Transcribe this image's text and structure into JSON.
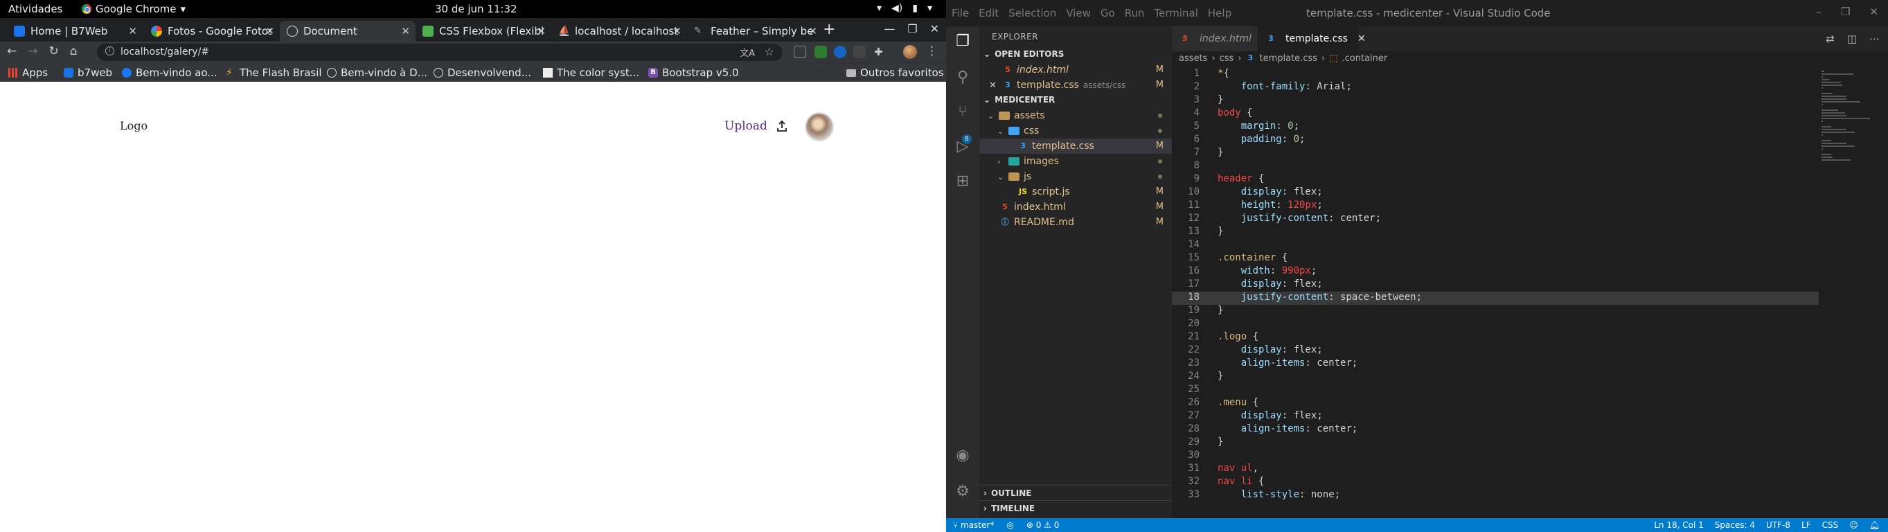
{
  "system": {
    "activities": "Atividades",
    "app_name": "Google Chrome",
    "clock": "30 de jun  11:32"
  },
  "chrome": {
    "tabs": [
      {
        "title": "Home | B7Web",
        "active": false
      },
      {
        "title": "Fotos - Google Fotos",
        "active": false
      },
      {
        "title": "Document",
        "active": true
      },
      {
        "title": "CSS Flexbox (Flexible",
        "active": false
      },
      {
        "title": "localhost / localhost",
        "active": false
      },
      {
        "title": "Feather – Simply be",
        "active": false
      }
    ],
    "url": "localhost/galery/#",
    "bookmarks": [
      {
        "label": "Apps",
        "icon": "apps-grid-icon"
      },
      {
        "label": "b7web",
        "icon": "b7web-icon"
      },
      {
        "label": "Bem-vindo ao...",
        "icon": "facebook-icon"
      },
      {
        "label": "The Flash Brasil",
        "icon": "flash-icon"
      },
      {
        "label": "Bem-vindo à D...",
        "icon": "globe-icon"
      },
      {
        "label": "Desenvolvend...",
        "icon": "globe-icon"
      },
      {
        "label": "The color syst...",
        "icon": "bookmark-icon"
      },
      {
        "label": "Bootstrap v5.0",
        "icon": "bootstrap-icon"
      }
    ],
    "other_bookmarks": "Outros favoritos"
  },
  "webpage": {
    "logo": "Logo",
    "upload": "Upload"
  },
  "vscode": {
    "menu": [
      "File",
      "Edit",
      "Selection",
      "View",
      "Go",
      "Run",
      "Terminal",
      "Help"
    ],
    "title": "template.css - medicenter - Visual Studio Code",
    "explorer_label": "EXPLORER",
    "open_editors_label": "OPEN EDITORS",
    "open_editors": [
      {
        "name": "index.html",
        "path": "",
        "status": "M",
        "type": "html"
      },
      {
        "name": "template.css",
        "path": "assets/css",
        "status": "M",
        "type": "css"
      }
    ],
    "project_label": "MEDICENTER",
    "tree": [
      {
        "name": "assets",
        "kind": "folder",
        "depth": 0,
        "open": true
      },
      {
        "name": "css",
        "kind": "folder-blue",
        "depth": 1,
        "open": true
      },
      {
        "name": "template.css",
        "kind": "css",
        "depth": 2,
        "status": "M",
        "selected": true
      },
      {
        "name": "images",
        "kind": "folder-img",
        "depth": 1,
        "open": false
      },
      {
        "name": "js",
        "kind": "folder",
        "depth": 1,
        "open": true
      },
      {
        "name": "script.js",
        "kind": "js",
        "depth": 2,
        "status": "M"
      },
      {
        "name": "index.html",
        "kind": "html",
        "depth": 0,
        "status": "M"
      },
      {
        "name": "README.md",
        "kind": "info",
        "depth": 0,
        "status": "M"
      }
    ],
    "outline_label": "OUTLINE",
    "timeline_label": "TIMELINE",
    "editor_tabs": [
      {
        "name": "index.html",
        "active": false,
        "type": "html"
      },
      {
        "name": "template.css",
        "active": true,
        "type": "css"
      }
    ],
    "breadcrumb": [
      "assets",
      "css",
      "template.css",
      ".container"
    ],
    "code": [
      {
        "n": 1,
        "tokens": [
          [
            "*",
            "t-sel"
          ],
          [
            "{",
            "t-plain"
          ]
        ]
      },
      {
        "n": 2,
        "tokens": [
          [
            "    font-family",
            "t-prop"
          ],
          [
            ": Arial;",
            "t-plain"
          ]
        ]
      },
      {
        "n": 3,
        "tokens": [
          [
            "}",
            "t-plain"
          ]
        ]
      },
      {
        "n": 4,
        "tokens": [
          [
            "body",
            "t-red"
          ],
          [
            " {",
            "t-plain"
          ]
        ]
      },
      {
        "n": 5,
        "tokens": [
          [
            "    margin",
            "t-prop"
          ],
          [
            ": ",
            "t-plain"
          ],
          [
            "0",
            "t-num"
          ],
          [
            ";",
            "t-plain"
          ]
        ]
      },
      {
        "n": 6,
        "tokens": [
          [
            "    padding",
            "t-prop"
          ],
          [
            ": ",
            "t-plain"
          ],
          [
            "0",
            "t-num"
          ],
          [
            ";",
            "t-plain"
          ]
        ]
      },
      {
        "n": 7,
        "tokens": [
          [
            "}",
            "t-plain"
          ]
        ]
      },
      {
        "n": 8,
        "tokens": []
      },
      {
        "n": 9,
        "tokens": [
          [
            "header",
            "t-red"
          ],
          [
            " {",
            "t-plain"
          ]
        ]
      },
      {
        "n": 10,
        "tokens": [
          [
            "    display",
            "t-prop"
          ],
          [
            ": flex;",
            "t-plain"
          ]
        ]
      },
      {
        "n": 11,
        "tokens": [
          [
            "    height",
            "t-prop"
          ],
          [
            ": ",
            "t-plain"
          ],
          [
            "120px",
            "t-red"
          ],
          [
            ";",
            "t-plain"
          ]
        ]
      },
      {
        "n": 12,
        "tokens": [
          [
            "    justify-content",
            "t-prop"
          ],
          [
            ": center;",
            "t-plain"
          ]
        ]
      },
      {
        "n": 13,
        "tokens": [
          [
            "}",
            "t-plain"
          ]
        ]
      },
      {
        "n": 14,
        "tokens": []
      },
      {
        "n": 15,
        "tokens": [
          [
            ".container",
            "t-sel"
          ],
          [
            " {",
            "t-plain"
          ]
        ]
      },
      {
        "n": 16,
        "tokens": [
          [
            "    width",
            "t-prop"
          ],
          [
            ": ",
            "t-plain"
          ],
          [
            "990px",
            "t-red"
          ],
          [
            ";",
            "t-plain"
          ]
        ]
      },
      {
        "n": 17,
        "tokens": [
          [
            "    display",
            "t-prop"
          ],
          [
            ": flex;",
            "t-plain"
          ]
        ]
      },
      {
        "n": 18,
        "tokens": [
          [
            "    justify-content",
            "t-prop"
          ],
          [
            ": space-between;",
            "t-plain"
          ]
        ],
        "current": true
      },
      {
        "n": 19,
        "tokens": [
          [
            "}",
            "t-plain"
          ]
        ]
      },
      {
        "n": 20,
        "tokens": []
      },
      {
        "n": 21,
        "tokens": [
          [
            ".logo",
            "t-sel"
          ],
          [
            " {",
            "t-plain"
          ]
        ]
      },
      {
        "n": 22,
        "tokens": [
          [
            "    display",
            "t-prop"
          ],
          [
            ": flex;",
            "t-plain"
          ]
        ]
      },
      {
        "n": 23,
        "tokens": [
          [
            "    align-items",
            "t-prop"
          ],
          [
            ": center;",
            "t-plain"
          ]
        ]
      },
      {
        "n": 24,
        "tokens": [
          [
            "}",
            "t-plain"
          ]
        ]
      },
      {
        "n": 25,
        "tokens": []
      },
      {
        "n": 26,
        "tokens": [
          [
            ".menu",
            "t-sel"
          ],
          [
            " {",
            "t-plain"
          ]
        ]
      },
      {
        "n": 27,
        "tokens": [
          [
            "    display",
            "t-prop"
          ],
          [
            ": flex;",
            "t-plain"
          ]
        ]
      },
      {
        "n": 28,
        "tokens": [
          [
            "    align-items",
            "t-prop"
          ],
          [
            ": center;",
            "t-plain"
          ]
        ]
      },
      {
        "n": 29,
        "tokens": [
          [
            "}",
            "t-plain"
          ]
        ]
      },
      {
        "n": 30,
        "tokens": []
      },
      {
        "n": 31,
        "tokens": [
          [
            "nav ul",
            "t-red"
          ],
          [
            ",",
            "t-plain"
          ]
        ]
      },
      {
        "n": 32,
        "tokens": [
          [
            "nav li",
            "t-red"
          ],
          [
            " {",
            "t-plain"
          ]
        ]
      },
      {
        "n": 33,
        "tokens": [
          [
            "    list-style",
            "t-prop"
          ],
          [
            ": none;",
            "t-plain"
          ]
        ]
      }
    ],
    "status": {
      "branch": "master*",
      "problems": "0",
      "warnings": "0",
      "position": "Ln 18, Col 1",
      "spaces": "Spaces: 4",
      "encoding": "UTF-8",
      "eol": "LF",
      "language": "CSS"
    }
  }
}
